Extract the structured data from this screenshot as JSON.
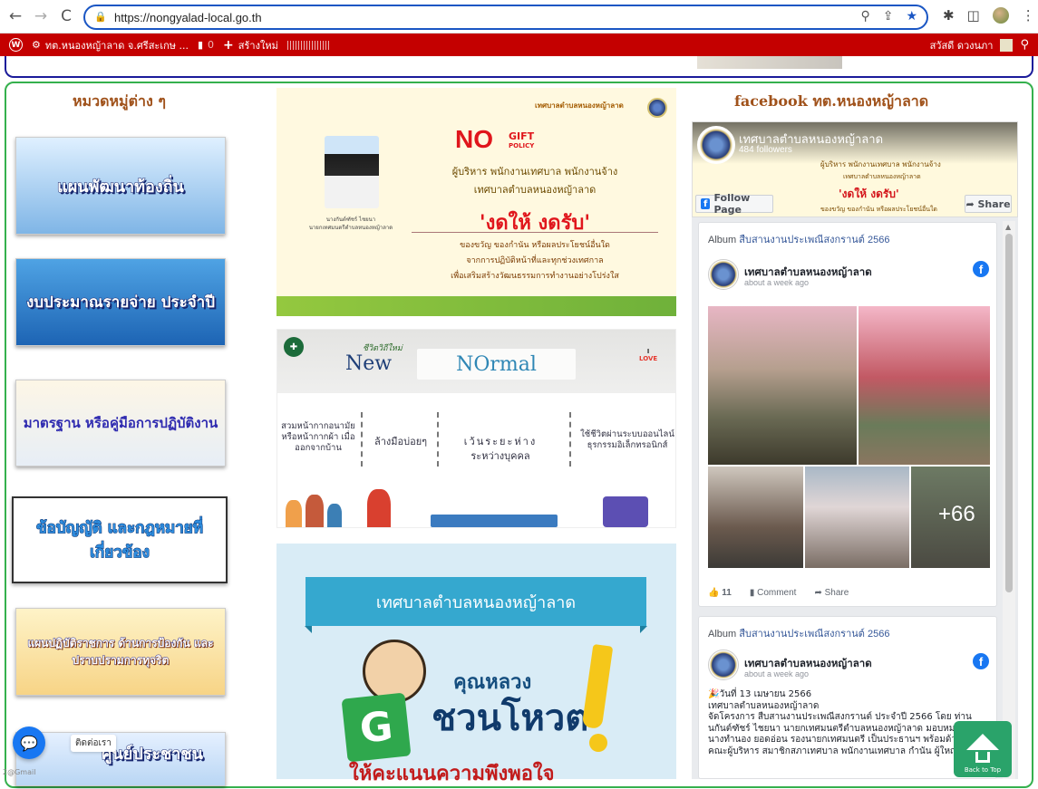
{
  "browser": {
    "url": "https://nongyalad-local.go.th",
    "icons": [
      "back-icon",
      "forward-icon",
      "reload-icon",
      "lock-icon",
      "zoom-icon",
      "share-icon",
      "star-icon",
      "extensions-icon",
      "sidepanel-icon",
      "profile-avatar",
      "menu-icon"
    ]
  },
  "admin_bar": {
    "site_name": "ทต.หนองหญ้าลาด จ.ศรีสะเกษ ...",
    "comments_count": "0",
    "new_label": "สร้างใหม่",
    "greeting": "สวัสดี ดวงนภา"
  },
  "left": {
    "title": "หมวดหมู่ต่าง ๆ",
    "categories": [
      {
        "label": "แผนพัฒนาท้องถิ่น"
      },
      {
        "label": "งบประมาณรายจ่าย ประจำปี"
      },
      {
        "label": "มาตรฐาน หรือคู่มือการปฏิบัติงาน"
      },
      {
        "label": "ข้อบัญญัติ และกฎหมายที่เกี่ยวข้อง"
      },
      {
        "label": "แผนปฏิบัติราชการ ด้านการป้องกัน และปราบปรามการทุจริต"
      },
      {
        "label": "ศูนย์ประชาชน"
      }
    ]
  },
  "center": {
    "nogift": {
      "header": "เทศบาลตำบลหนองหญ้าลาด",
      "no": "NO",
      "gift": "GIFT",
      "policy": "POLICY",
      "line1": "ผู้บริหาร พนักงานเทศบาล พนักงานจ้าง",
      "line2": "เทศบาลตำบลหนองหญ้าลาด",
      "slogan": "'งดให้ งดรับ'",
      "sub1": "ของขวัญ ของกำนัน หรือผลประโยชน์อื่นใด",
      "sub2": "จากการปฏิบัติหน้าที่และทุกช่วงเทศกาล",
      "sub3": "เพื่อเสริมสร้างวัฒนธรรมการทำงานอย่างโปร่งใส",
      "caption1": "นางกันต์ฑัชร์ ไชยนา",
      "caption2": "นายกเทศมนตรีตำบลหนองหญ้าลาด"
    },
    "newnormal": {
      "tagline": "ชีวิตวิถีใหม่",
      "new": "New",
      "normal": "NOrmal",
      "love_top": "I",
      "love": "LOVE",
      "col1": "สวมหน้ากากอนามัย หรือหน้ากากผ้า เมื่อออกจากบ้าน",
      "col2": "ล้างมือบ่อยๆ",
      "col3a": "เว้นระยะห่าง",
      "col3b": "ระหว่างบุคคล",
      "col4": "ใช้ชีวิตผ่านระบบออนไลน์ ธุรกรรมอิเล็กทรอนิกส์"
    },
    "vote": {
      "banner": "เทศบาลตำบลหนองหญ้าลาด",
      "khun": "คุณหลวง",
      "chuan": "ชวนโหวต",
      "g": "G",
      "bottom": "ให้คะแนนความพึงพอใจ"
    }
  },
  "right": {
    "title": "facebook ทต.หนองหญ้าลาด",
    "page_name": "เทศบาลตำบลหนองหญ้าลาด",
    "followers": "484 followers",
    "follow_label": "Follow Page",
    "share_label": "Share",
    "cover_slogan": "'งดให้ งดรับ'",
    "posts": [
      {
        "album_prefix": "Album",
        "album_name": "สืบสานงานประเพณีสงกรานต์ 2566",
        "author": "เทศบาลตำบลหนองหญ้าลาด",
        "time": "about a week ago",
        "more_photos": "+66",
        "likes": "11",
        "comment_label": "Comment",
        "share_label": "Share"
      },
      {
        "album_prefix": "Album",
        "album_name": "สืบสานงานประเพณีสงกรานต์ 2566",
        "author": "เทศบาลตำบลหนองหญ้าลาด",
        "time": "about a week ago",
        "text1": "วันที่ 13 เมษายน 2566",
        "text2": "เทศบาลตำบลหนองหญ้าลาด",
        "text3": "จัดโครงการ สืบสานงานประเพณีสงกรานต์ ประจำปี 2566 โดย ท่าน",
        "text4": "นกันต์ฑัชร์ ไชยนา นายกเทศมนตรีตำบลหนองหญ้าลาด มอบหมายให้",
        "text5": "นางทำนอง ยอดอ่อน รองนายกเทศมนตรี เป็นประธานฯ พร้อมด้วย",
        "text6": "คณะผู้บริหาร สมาชิกสภาเทศบาล พนักงานเทศบาล กำนัน ผู้ใหญ่"
      }
    ]
  },
  "widgets": {
    "chat_label": "ติดต่อเรา",
    "back_to_top": "Back to Top",
    "corner": "2@Gmail"
  }
}
